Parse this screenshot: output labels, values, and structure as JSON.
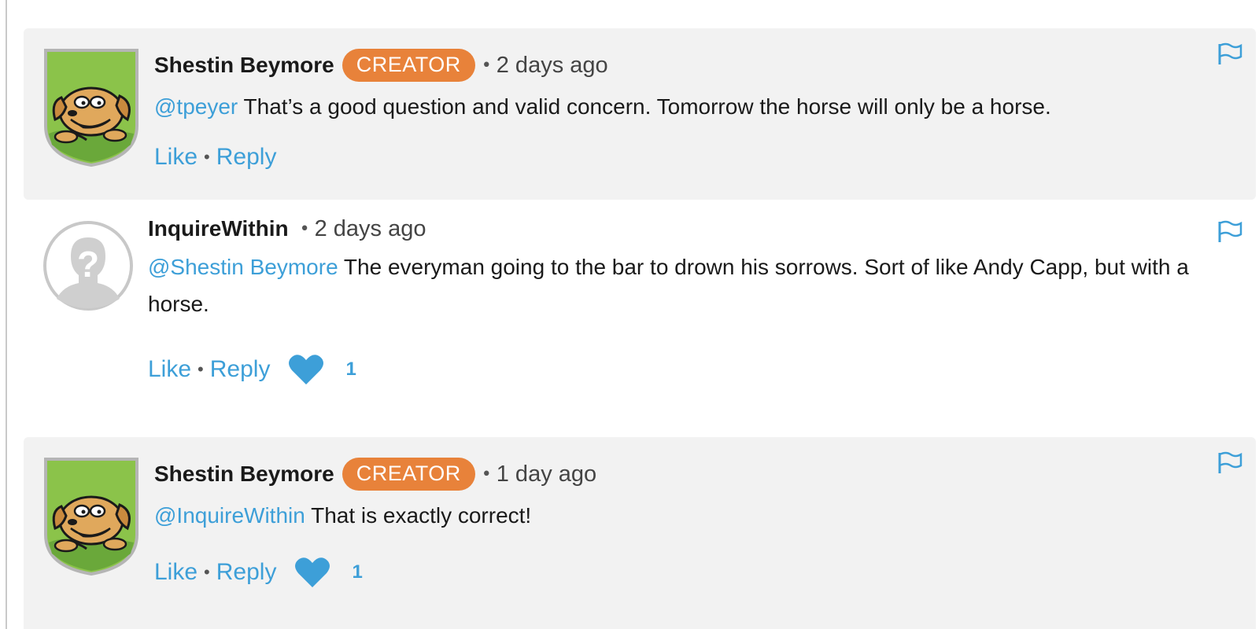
{
  "comments": [
    {
      "author": "Shestin Beymore",
      "badge": "CREATOR",
      "separator": "•",
      "time": "2 days ago",
      "mention": "@tpeyer",
      "text": "That’s a good question and valid concern. Tomorrow the horse will only be a horse.",
      "like_label": "Like",
      "reply_label": "Reply",
      "avatar_icon": "cartoon-dog-shield-icon",
      "flag_icon": "flag-icon"
    },
    {
      "author": "InquireWithin",
      "separator": "•",
      "time": "2 days ago",
      "mention": "@Shestin Beymore",
      "text": "The everyman going to the bar to drown his sorrows. Sort of like Andy Capp, but with a horse.",
      "like_label": "Like",
      "reply_label": "Reply",
      "like_count": "1",
      "avatar_icon": "anonymous-avatar-icon",
      "heart_icon": "heart-icon",
      "flag_icon": "flag-icon"
    },
    {
      "author": "Shestin Beymore",
      "badge": "CREATOR",
      "separator": "•",
      "time": "1 day ago",
      "mention": "@InquireWithin",
      "text": "That is exactly correct!",
      "like_label": "Like",
      "reply_label": "Reply",
      "like_count": "1",
      "avatar_icon": "cartoon-dog-shield-icon",
      "heart_icon": "heart-icon",
      "flag_icon": "flag-icon"
    }
  ],
  "colors": {
    "accent_blue": "#3d9fd8",
    "creator_badge": "#e8823a",
    "creator_bg": "#f2f2f2",
    "avatar_green": "#8bc34a"
  }
}
